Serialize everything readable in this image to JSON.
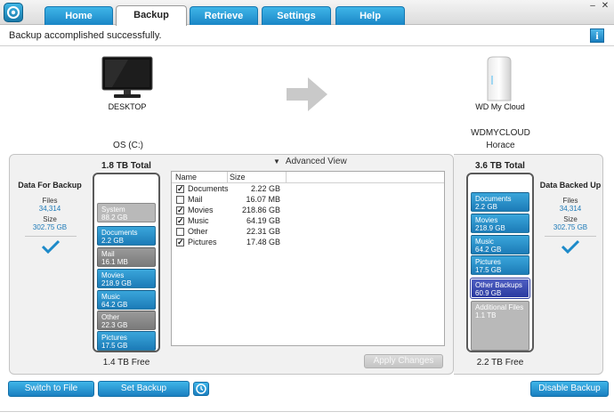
{
  "tabs": [
    {
      "label": "Home"
    },
    {
      "label": "Backup"
    },
    {
      "label": "Retrieve"
    },
    {
      "label": "Settings"
    },
    {
      "label": "Help"
    }
  ],
  "active_tab": "Backup",
  "status_message": "Backup accomplished successfully.",
  "source": {
    "device": "DESKTOP",
    "volume": "OS (C:)",
    "total": "1.8 TB Total",
    "free": "1.4 TB Free",
    "segments": [
      {
        "name": "System",
        "size": "88.2 GB",
        "color": "lightgray"
      },
      {
        "name": "Documents",
        "size": "2.2 GB",
        "color": "blue"
      },
      {
        "name": "Mail",
        "size": "16.1 MB",
        "color": "gray"
      },
      {
        "name": "Movies",
        "size": "218.9 GB",
        "color": "blue"
      },
      {
        "name": "Music",
        "size": "64.2 GB",
        "color": "blue"
      },
      {
        "name": "Other",
        "size": "22.3 GB",
        "color": "gray"
      },
      {
        "name": "Pictures",
        "size": "17.5 GB",
        "color": "blue"
      }
    ]
  },
  "destination": {
    "device": "WD My Cloud",
    "name": "WDMYCLOUD",
    "share": "Horace",
    "total": "3.6 TB Total",
    "free": "2.2 TB Free",
    "segments": [
      {
        "name": "Documents",
        "size": "2.2 GB",
        "color": "blue"
      },
      {
        "name": "Movies",
        "size": "218.9 GB",
        "color": "blue"
      },
      {
        "name": "Music",
        "size": "64.2 GB",
        "color": "blue"
      },
      {
        "name": "Pictures",
        "size": "17.5 GB",
        "color": "blue"
      },
      {
        "name": "Other Backups",
        "size": "60.9 GB",
        "color": "navy"
      },
      {
        "name": "Additional Files",
        "size": "1.1 TB",
        "color": "lightgray"
      }
    ]
  },
  "left_summary": {
    "title": "Data For Backup",
    "files_label": "Files",
    "files_value": "34,314",
    "size_label": "Size",
    "size_value": "302.75 GB"
  },
  "right_summary": {
    "title": "Data Backed Up",
    "files_label": "Files",
    "files_value": "34,314",
    "size_label": "Size",
    "size_value": "302.75 GB"
  },
  "advanced": {
    "title": "Advanced View",
    "col_name": "Name",
    "col_size": "Size",
    "rows": [
      {
        "name": "Documents",
        "size": "2.22 GB",
        "checked": true
      },
      {
        "name": "Mail",
        "size": "16.07 MB",
        "checked": false
      },
      {
        "name": "Movies",
        "size": "218.86 GB",
        "checked": true
      },
      {
        "name": "Music",
        "size": "64.19 GB",
        "checked": true
      },
      {
        "name": "Other",
        "size": "22.31 GB",
        "checked": false
      },
      {
        "name": "Pictures",
        "size": "17.48 GB",
        "checked": true
      }
    ],
    "apply_label": "Apply Changes"
  },
  "buttons": {
    "switch_label": "Switch to File Backup",
    "frequency_label": "Set Backup Frequency",
    "disable_label": "Disable Backup"
  },
  "colors": {
    "accent": "#1a86c6",
    "check": "#1d8ac9",
    "navy": "#2a3aa0"
  }
}
